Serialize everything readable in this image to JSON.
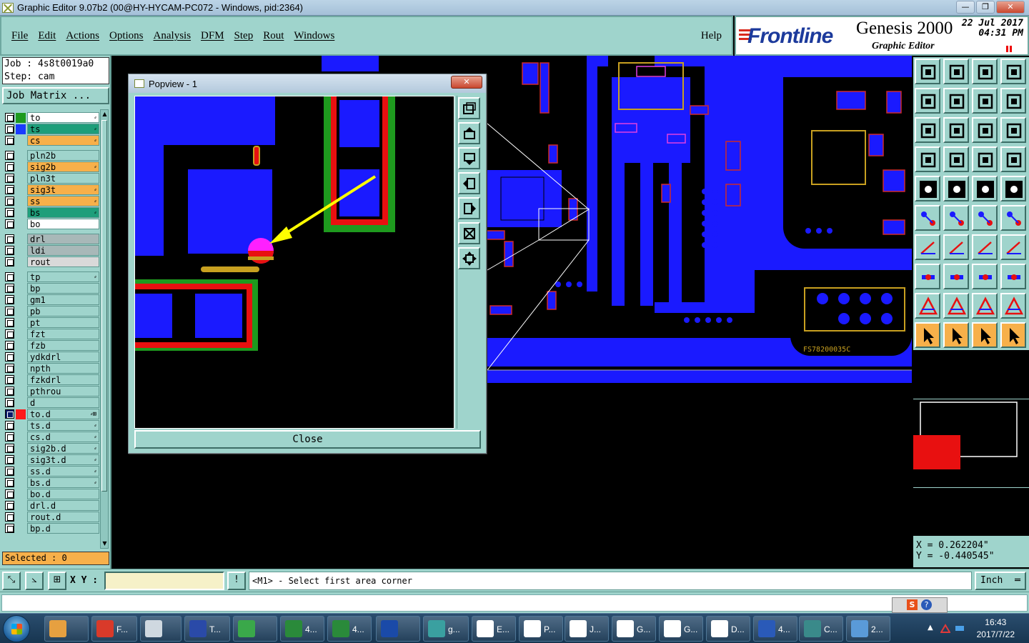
{
  "window": {
    "title": "Graphic Editor 9.07b2 (00@HY-HYCAM-PC072 - Windows, pid:2364)",
    "minimize": "—",
    "maximize": "❐",
    "close": "✕"
  },
  "menu": {
    "items": [
      "File",
      "Edit",
      "Actions",
      "Options",
      "Analysis",
      "DFM",
      "Step",
      "Rout",
      "Windows"
    ],
    "help": "Help"
  },
  "brand": {
    "logo": "Frontline",
    "product": "Genesis 2000",
    "subtitle": "Graphic Editor",
    "date": "22 Jul 2017",
    "time": "04:31 PM"
  },
  "job": {
    "job_line": "Job : 4s8t0019a0",
    "step_line": "Step: cam",
    "matrix_button": "Job Matrix ...",
    "selected": "Selected : 0"
  },
  "layers": [
    {
      "name": "to",
      "color": "#ffffff",
      "swatch": "#1e9a1e",
      "mark": "⸗",
      "active": false
    },
    {
      "name": "ts",
      "color": "#1e9e7a",
      "swatch": "#1a3aff",
      "mark": "⸗",
      "active": false
    },
    {
      "name": "cs",
      "color": "#f7b04a",
      "swatch": "#9fd4cc",
      "mark": "⸗",
      "active": false
    },
    {
      "name": "pln2b",
      "color": "#9fd4cc",
      "swatch": "#9fd4cc",
      "mark": "",
      "active": false
    },
    {
      "name": "sig2b",
      "color": "#f7b04a",
      "swatch": "#9fd4cc",
      "mark": "⸗",
      "active": false
    },
    {
      "name": "pln3t",
      "color": "#9fd4cc",
      "swatch": "#9fd4cc",
      "mark": "",
      "active": false
    },
    {
      "name": "sig3t",
      "color": "#f7b04a",
      "swatch": "#9fd4cc",
      "mark": "⸗",
      "active": false
    },
    {
      "name": "ss",
      "color": "#f7b04a",
      "swatch": "#9fd4cc",
      "mark": "⸗",
      "active": false
    },
    {
      "name": "bs",
      "color": "#1e9e7a",
      "swatch": "#9fd4cc",
      "mark": "⸗",
      "active": false
    },
    {
      "name": "bo",
      "color": "#ffffff",
      "swatch": "#9fd4cc",
      "mark": "",
      "active": false
    },
    {
      "name": "drl",
      "color": "#a8b8b8",
      "swatch": "#9fd4cc",
      "mark": "",
      "active": false
    },
    {
      "name": "ldi",
      "color": "#a8b8b8",
      "swatch": "#9fd4cc",
      "mark": "",
      "active": false
    },
    {
      "name": "rout",
      "color": "#d9d9d9",
      "swatch": "#9fd4cc",
      "mark": "",
      "active": false
    },
    {
      "name": "tp",
      "color": "#9fd4cc",
      "swatch": "#9fd4cc",
      "mark": "⸗",
      "active": false
    },
    {
      "name": "bp",
      "color": "#9fd4cc",
      "swatch": "#9fd4cc",
      "mark": "",
      "active": false
    },
    {
      "name": "gm1",
      "color": "#9fd4cc",
      "swatch": "#9fd4cc",
      "mark": "",
      "active": false
    },
    {
      "name": "pb",
      "color": "#9fd4cc",
      "swatch": "#9fd4cc",
      "mark": "",
      "active": false
    },
    {
      "name": "pt",
      "color": "#9fd4cc",
      "swatch": "#9fd4cc",
      "mark": "",
      "active": false
    },
    {
      "name": "fzt",
      "color": "#9fd4cc",
      "swatch": "#9fd4cc",
      "mark": "",
      "active": false
    },
    {
      "name": "fzb",
      "color": "#9fd4cc",
      "swatch": "#9fd4cc",
      "mark": "",
      "active": false
    },
    {
      "name": "ydkdrl",
      "color": "#9fd4cc",
      "swatch": "#9fd4cc",
      "mark": "",
      "active": false
    },
    {
      "name": "npth",
      "color": "#9fd4cc",
      "swatch": "#9fd4cc",
      "mark": "",
      "active": false
    },
    {
      "name": "fzkdrl",
      "color": "#9fd4cc",
      "swatch": "#9fd4cc",
      "mark": "",
      "active": false
    },
    {
      "name": "pthrou",
      "color": "#9fd4cc",
      "swatch": "#9fd4cc",
      "mark": "",
      "active": false
    },
    {
      "name": "d",
      "color": "#9fd4cc",
      "swatch": "#9fd4cc",
      "mark": "",
      "active": false
    },
    {
      "name": "to.d",
      "color": "#9fd4cc",
      "swatch": "#ff1a1a",
      "mark": "⸗⊞",
      "active": true
    },
    {
      "name": "ts.d",
      "color": "#9fd4cc",
      "swatch": "#9fd4cc",
      "mark": "⸗",
      "active": false
    },
    {
      "name": "cs.d",
      "color": "#9fd4cc",
      "swatch": "#9fd4cc",
      "mark": "⸗",
      "active": false
    },
    {
      "name": "sig2b.d",
      "color": "#9fd4cc",
      "swatch": "#9fd4cc",
      "mark": "⸗",
      "active": false
    },
    {
      "name": "sig3t.d",
      "color": "#9fd4cc",
      "swatch": "#9fd4cc",
      "mark": "⸗",
      "active": false
    },
    {
      "name": "ss.d",
      "color": "#9fd4cc",
      "swatch": "#9fd4cc",
      "mark": "⸗",
      "active": false
    },
    {
      "name": "bs.d",
      "color": "#9fd4cc",
      "swatch": "#9fd4cc",
      "mark": "⸗",
      "active": false
    },
    {
      "name": "bo.d",
      "color": "#9fd4cc",
      "swatch": "#9fd4cc",
      "mark": "",
      "active": false
    },
    {
      "name": "drl.d",
      "color": "#9fd4cc",
      "swatch": "#9fd4cc",
      "mark": "",
      "active": false
    },
    {
      "name": "rout.d",
      "color": "#9fd4cc",
      "swatch": "#9fd4cc",
      "mark": "",
      "active": false
    },
    {
      "name": "bp.d",
      "color": "#9fd4cc",
      "swatch": "#9fd4cc",
      "mark": "",
      "active": false
    }
  ],
  "popview": {
    "title": "Popview - 1",
    "close_label": "Close"
  },
  "coords": {
    "x": "X = 0.262204\"",
    "y": "Y = -0.440545\""
  },
  "command": {
    "xy_label": "X Y :",
    "xy_value": "",
    "message": "<M1> - Select first area corner",
    "units": "Inch"
  },
  "board_text": {
    "silk1": "FS78200035C"
  },
  "taskbar": {
    "items": [
      {
        "label": "",
        "icon": "shell-icon",
        "color": "#e6a040"
      },
      {
        "label": "F...",
        "icon": "app-red-icon",
        "color": "#d93a2a"
      },
      {
        "label": "",
        "icon": "notepad-icon",
        "color": "#cfd8e0"
      },
      {
        "label": "T...",
        "icon": "floppy-icon",
        "color": "#2a4aa8"
      },
      {
        "label": "",
        "icon": "green-p-icon",
        "color": "#3aa84a"
      },
      {
        "label": "4...",
        "icon": "excel-icon",
        "color": "#2a8a3a"
      },
      {
        "label": "4...",
        "icon": "excel-icon",
        "color": "#2a8a3a"
      },
      {
        "label": "",
        "icon": "frontline-icon",
        "color": "#1a4aa8"
      },
      {
        "label": "g...",
        "icon": "eye-icon",
        "color": "#3aa0a0"
      },
      {
        "label": "E...",
        "icon": "genesis-icon",
        "color": "#ffffff"
      },
      {
        "label": "P...",
        "icon": "genesis-icon",
        "color": "#ffffff"
      },
      {
        "label": "J...",
        "icon": "genesis-icon",
        "color": "#ffffff"
      },
      {
        "label": "G...",
        "icon": "genesis-icon",
        "color": "#ffffff"
      },
      {
        "label": "G...",
        "icon": "genesis-icon",
        "color": "#ffffff"
      },
      {
        "label": "D...",
        "icon": "genesis-icon",
        "color": "#ffffff"
      },
      {
        "label": "4...",
        "icon": "word-icon",
        "color": "#2a5ab8"
      },
      {
        "label": "C...",
        "icon": "pcb-icon",
        "color": "#3a8a8a"
      },
      {
        "label": "2...",
        "icon": "picture-icon",
        "color": "#5a9ad8"
      }
    ],
    "time": "16:43",
    "date": "2017/7/22"
  }
}
